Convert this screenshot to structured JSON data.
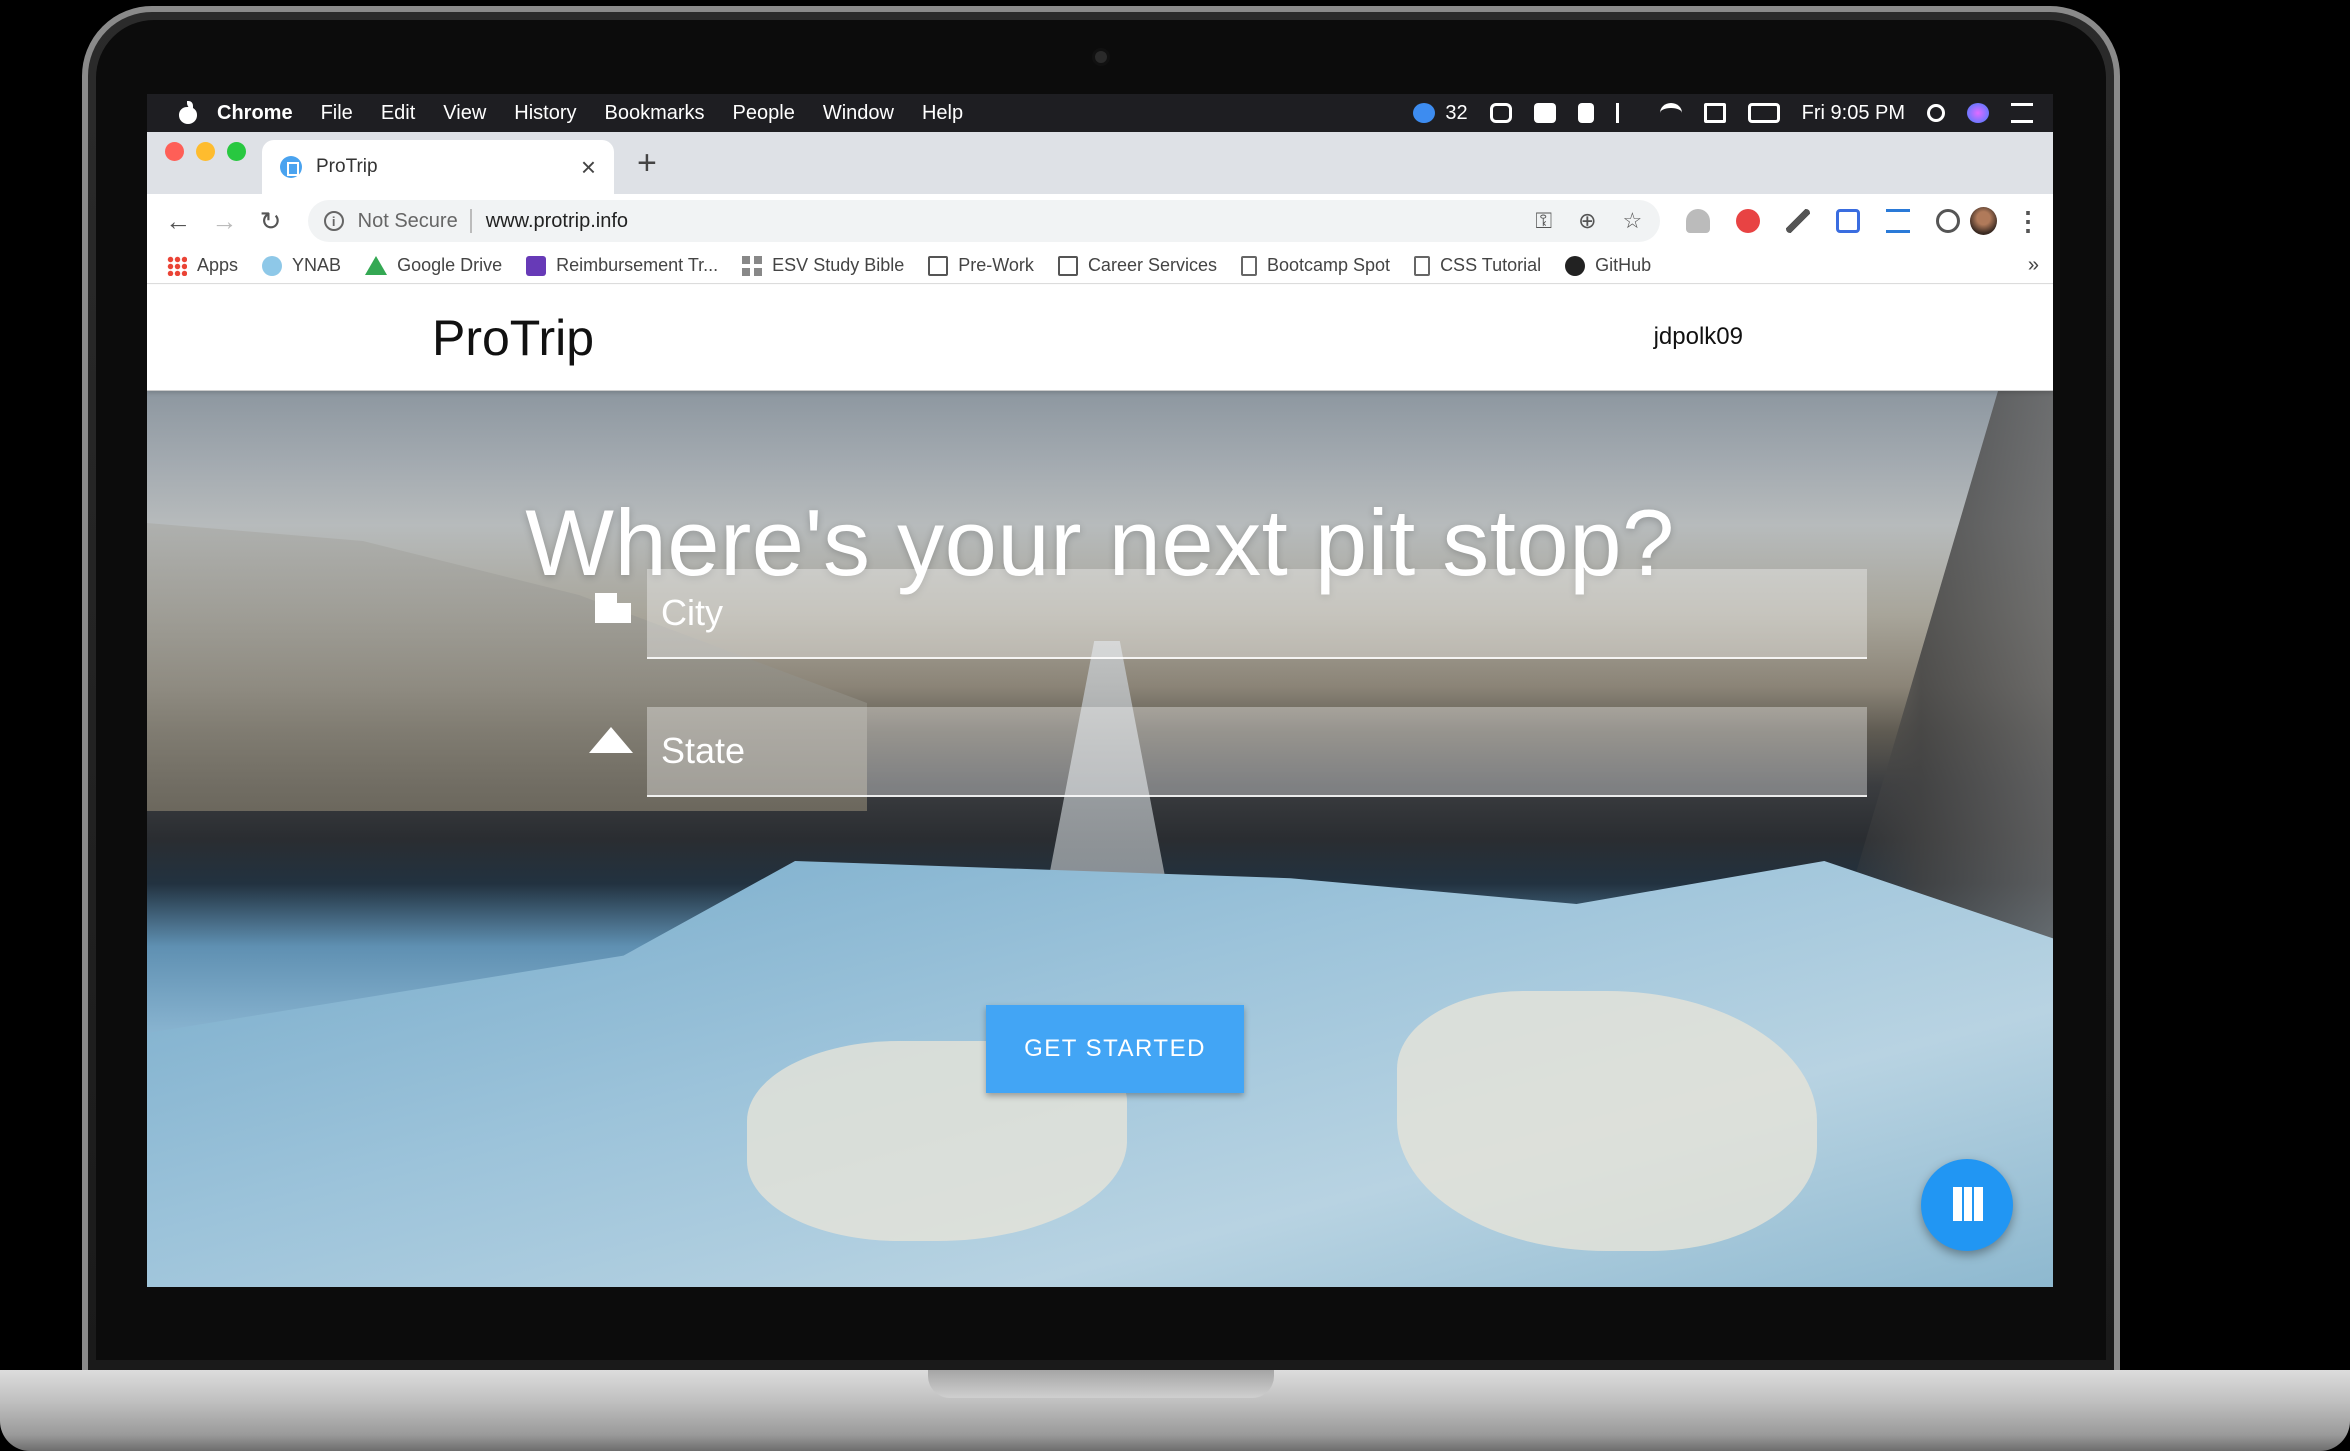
{
  "menubar": {
    "app": "Chrome",
    "items": [
      "File",
      "Edit",
      "View",
      "History",
      "Bookmarks",
      "People",
      "Window",
      "Help"
    ],
    "badge_count": "32",
    "clock": "Fri 9:05 PM"
  },
  "browser": {
    "tab_title": "ProTrip",
    "tab_close": "×",
    "new_tab": "+",
    "security_label": "Not Secure",
    "url": "www.protrip.info",
    "bookmarks": [
      "Apps",
      "YNAB",
      "Google Drive",
      "Reimbursement Tr...",
      "ESV Study Bible",
      "Pre-Work",
      "Career Services",
      "Bootcamp Spot",
      "CSS Tutorial",
      "GitHub"
    ],
    "bookmarks_more": "»"
  },
  "site": {
    "brand": "ProTrip",
    "username": "jdpolk09",
    "headline": "Where's your next pit stop?",
    "city_placeholder": "City",
    "state_placeholder": "State",
    "cta_label": "GET STARTED"
  },
  "colors": {
    "primary": "#42a5f5",
    "fab": "#2196f3"
  },
  "icons": [
    "apple-icon",
    "key-icon",
    "zoom-icon",
    "star-icon",
    "city-icon",
    "mountain-icon",
    "map-icon"
  ]
}
